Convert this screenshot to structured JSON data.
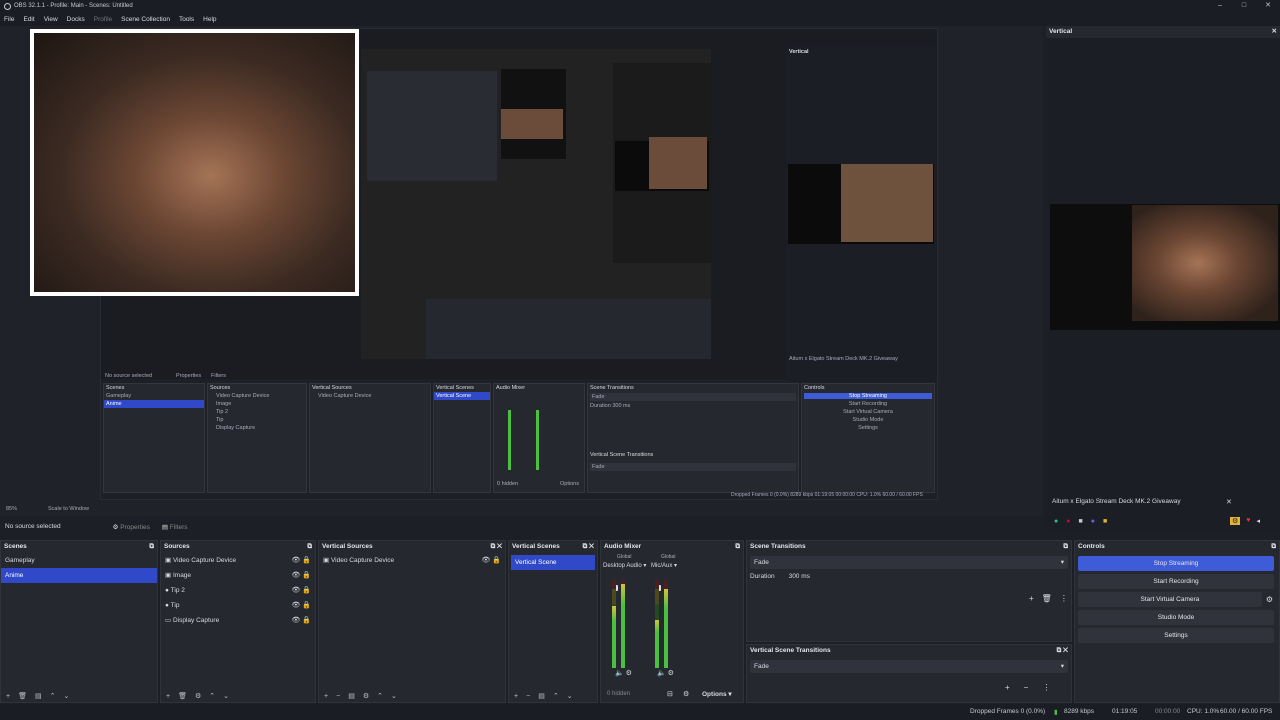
{
  "window": {
    "title": "OBS 32.1.1 - Profile: Main - Scenes: Untitled"
  },
  "menu": [
    "File",
    "Edit",
    "View",
    "Docks",
    "Profile",
    "Scene Collection",
    "Tools",
    "Help"
  ],
  "source_bar": {
    "status": "No source selected",
    "properties": "Properties",
    "filters": "Filters"
  },
  "scenes": {
    "title": "Scenes",
    "items": [
      "Gameplay",
      "Anime"
    ],
    "selected": 1
  },
  "sources": {
    "title": "Sources",
    "items": [
      "Video Capture Device",
      "Image",
      "Tip 2",
      "Tip",
      "Display Capture"
    ]
  },
  "vertical_sources": {
    "title": "Vertical Sources",
    "items": [
      "Video Capture Device"
    ]
  },
  "vertical_scenes": {
    "title": "Vertical Scenes",
    "items": [
      "Vertical Scene"
    ]
  },
  "audio_mixer": {
    "title": "Audio Mixer",
    "global1": "Global",
    "global2": "Global",
    "ch1": "Desktop Audio",
    "ch2": "Mic/Aux",
    "hidden": "0 hidden",
    "options": "Options",
    "ticks": [
      "0",
      "-6",
      "-12",
      "-18",
      "-24",
      "-30",
      "-36",
      "-42",
      "-48",
      "-54",
      "-60"
    ]
  },
  "scene_transitions": {
    "title": "Scene Transitions",
    "type": "Fade",
    "duration_label": "Duration",
    "duration_value": "300 ms"
  },
  "vertical_transitions": {
    "title": "Vertical Scene Transitions",
    "type": "Fade"
  },
  "controls": {
    "title": "Controls",
    "stop_streaming": "Stop Streaming",
    "start_recording": "Start Recording",
    "start_virtual_camera": "Start Virtual Camera",
    "studio_mode": "Studio Mode",
    "settings": "Settings"
  },
  "vertical_dock": {
    "title": "Vertical",
    "caption": "Aitum x Elgato Stream Deck MK.2 Giveaway"
  },
  "status_bar": {
    "dropped": "Dropped Frames 0 (0.0%)",
    "kbps": "8289 kbps",
    "stream_time": "01:19:05",
    "rec_time": "00:00:00",
    "cpu": "CPU: 1.0%",
    "fps": "60.00 / 60.00 FPS"
  },
  "mini": {
    "status": "No source selected",
    "properties": "Properties",
    "filters": "Filters",
    "scenes": "Scenes",
    "scene_items": [
      "Gameplay",
      "Anime"
    ],
    "sources": "Sources",
    "source_items": [
      "Video Capture Device",
      "Image",
      "Tip 2",
      "Tip",
      "Display Capture"
    ],
    "vsources": "Vertical Sources",
    "vsource_item": "Video Capture Device",
    "vscenes": "Vertical Scenes",
    "vscene_item": "Vertical Scene",
    "mixer": "Audio Mixer",
    "transitions": "Scene Transitions",
    "fade": "Fade",
    "duration": "Duration",
    "duration_value": "300 ms",
    "vtransitions": "Vertical Scene Transitions",
    "controls": "Controls",
    "ctl": [
      "Stop Streaming",
      "Start Recording",
      "Start Virtual Camera",
      "Studio Mode",
      "Settings"
    ],
    "vertical": "Vertical",
    "caption": "Aitum x Elgato Stream Deck MK.2 Giveaway",
    "hidden": "0 hidden",
    "options": "Options",
    "status_right": "Dropped Frames 0 (0.0%)   8289 kbps   01:19:05   00:00:00   CPU: 1.0%   60.00 / 60.00 FPS",
    "zoom": "85%",
    "scale": "Scale to Window"
  },
  "colors": {
    "accent": "#3e5bd8",
    "selection": "#2f49c8",
    "bg": "#1d1f26"
  }
}
